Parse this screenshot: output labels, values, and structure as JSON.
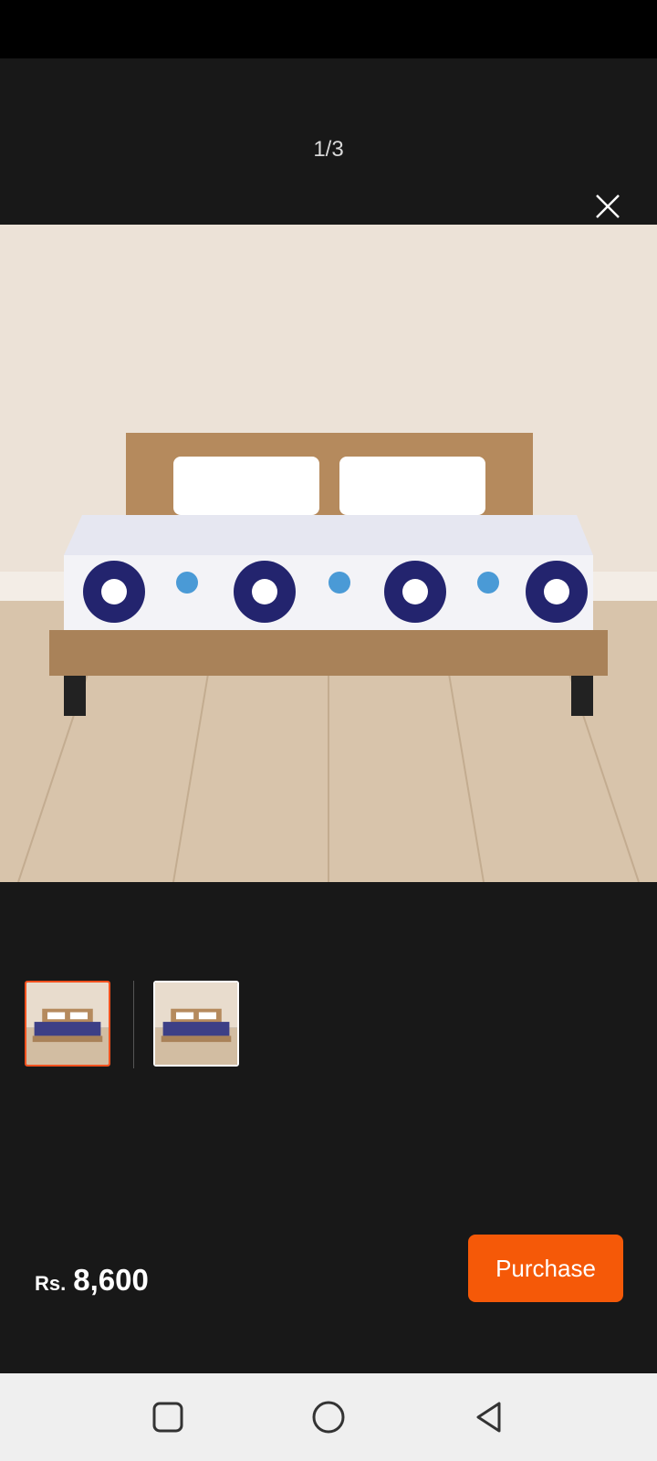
{
  "gallery": {
    "counter": "1/3",
    "main_image": "mattress-on-wooden-bed",
    "thumbnails": [
      {
        "image": "mattress-on-wooden-bed",
        "selected": true
      },
      {
        "image": "mattress-on-wooden-bed",
        "selected": false
      }
    ]
  },
  "footer": {
    "currency": "Rs.",
    "price": "8,600",
    "purchase_label": "Purchase"
  },
  "colors": {
    "background": "#181818",
    "accent": "#f55908",
    "selected_border": "#f4511e"
  },
  "icons": {
    "close": "close-icon",
    "recents": "square-icon",
    "home": "circle-icon",
    "back": "triangle-back-icon"
  }
}
